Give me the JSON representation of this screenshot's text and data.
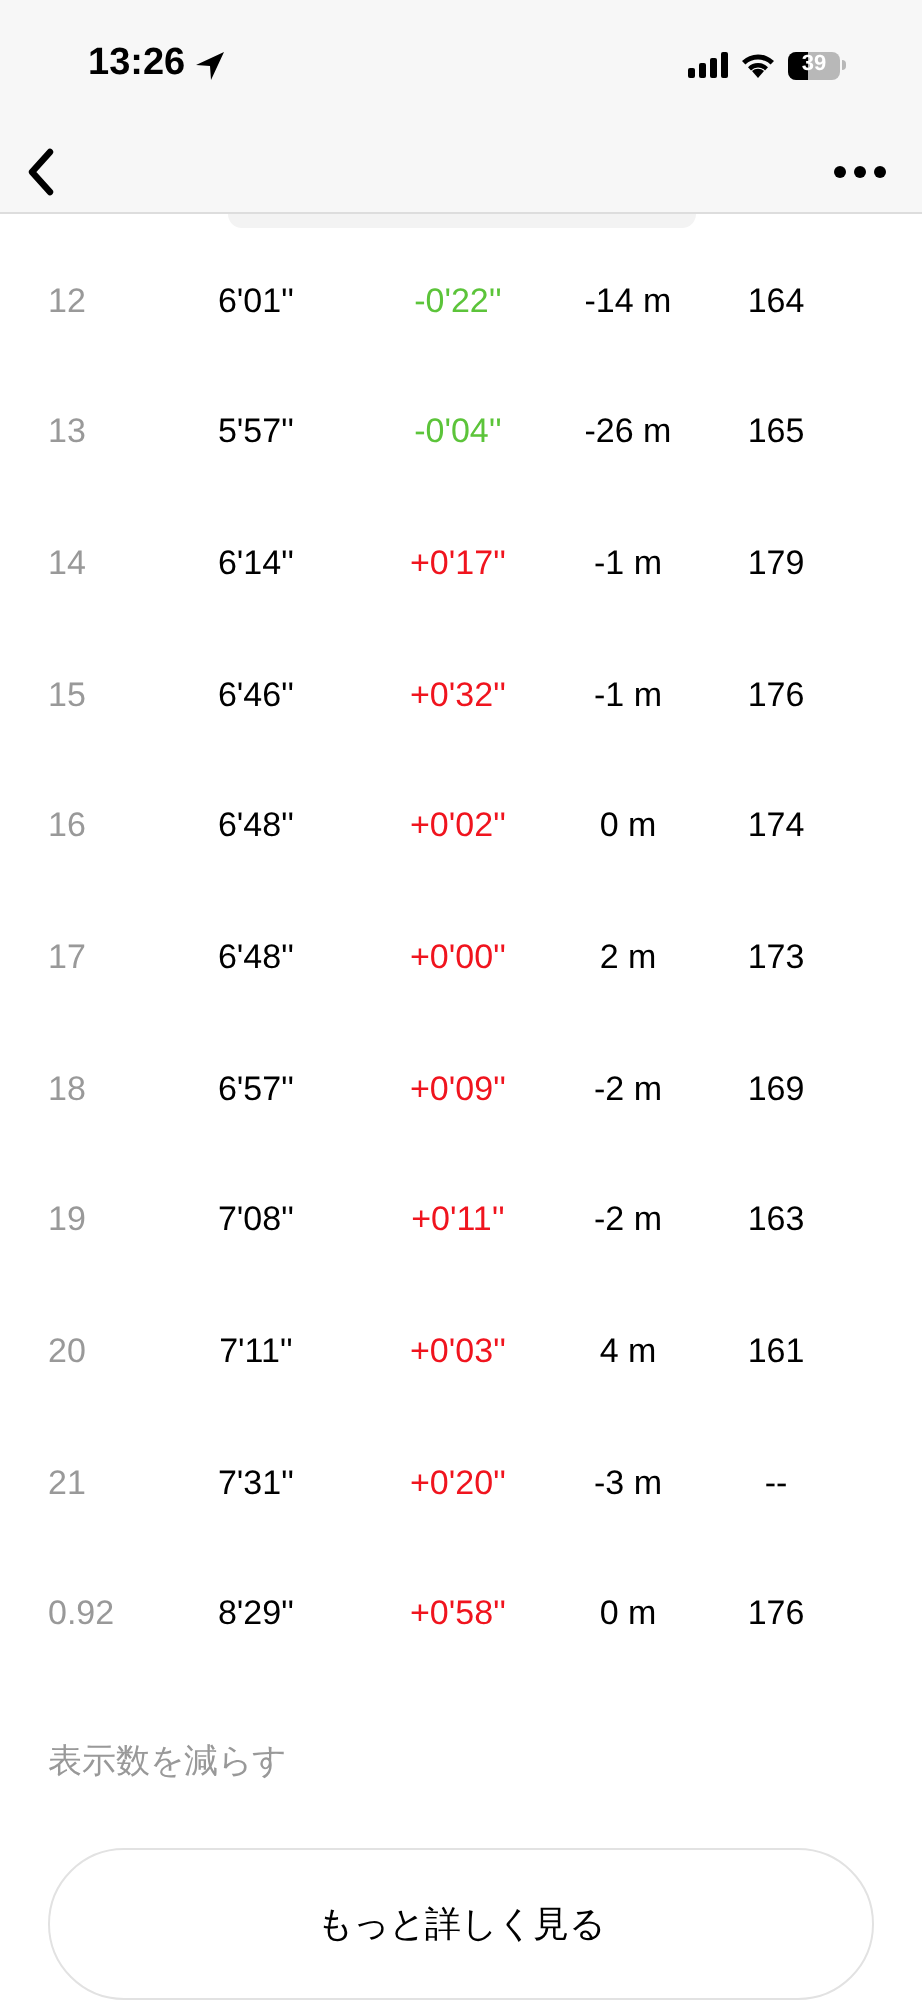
{
  "status_bar": {
    "time": "13:26",
    "battery": "39"
  },
  "splits": [
    {
      "index": "12",
      "pace": "6'01''",
      "diff": "-0'22''",
      "color": "#5cc43a",
      "elevation": "-14 m",
      "heart_rate": "164"
    },
    {
      "index": "13",
      "pace": "5'57''",
      "diff": "-0'04''",
      "color": "#5cc43a",
      "elevation": "-26 m",
      "heart_rate": "165"
    },
    {
      "index": "14",
      "pace": "6'14''",
      "diff": "+0'17''",
      "color": "#f0141e",
      "elevation": "-1 m",
      "heart_rate": "179"
    },
    {
      "index": "15",
      "pace": "6'46''",
      "diff": "+0'32''",
      "color": "#f0141e",
      "elevation": "-1 m",
      "heart_rate": "176"
    },
    {
      "index": "16",
      "pace": "6'48''",
      "diff": "+0'02''",
      "color": "#f0141e",
      "elevation": "0 m",
      "heart_rate": "174"
    },
    {
      "index": "17",
      "pace": "6'48''",
      "diff": "+0'00''",
      "color": "#f0141e",
      "elevation": "2 m",
      "heart_rate": "173"
    },
    {
      "index": "18",
      "pace": "6'57''",
      "diff": "+0'09''",
      "color": "#f0141e",
      "elevation": "-2 m",
      "heart_rate": "169"
    },
    {
      "index": "19",
      "pace": "7'08''",
      "diff": "+0'11''",
      "color": "#f0141e",
      "elevation": "-2 m",
      "heart_rate": "163"
    },
    {
      "index": "20",
      "pace": "7'11''",
      "diff": "+0'03''",
      "color": "#f0141e",
      "elevation": "4 m",
      "heart_rate": "161"
    },
    {
      "index": "21",
      "pace": "7'31''",
      "diff": "+0'20''",
      "color": "#f0141e",
      "elevation": "-3 m",
      "heart_rate": "--"
    },
    {
      "index": "0.92",
      "pace": "8'29''",
      "diff": "+0'58''",
      "color": "#f0141e",
      "elevation": "0 m",
      "heart_rate": "176"
    }
  ],
  "show_less": "表示数を減らす",
  "more_button": "もっと詳しく見る"
}
